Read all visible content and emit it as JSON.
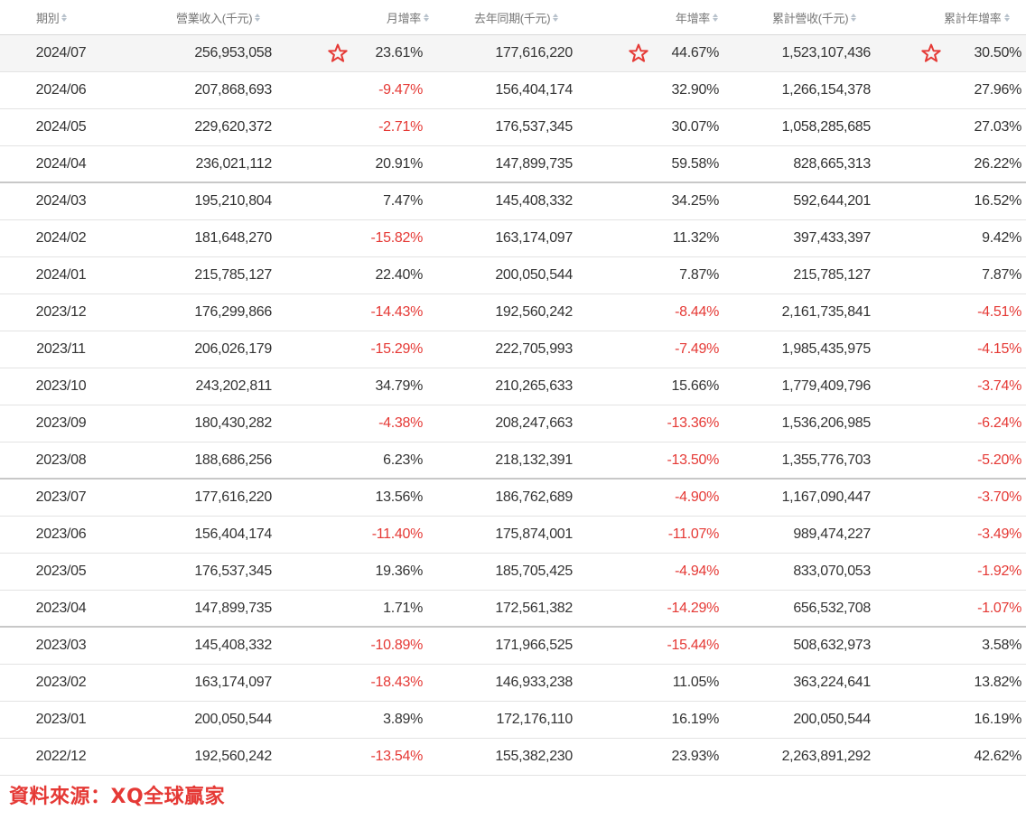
{
  "table": {
    "headers": {
      "period": "期別",
      "revenue": "營業收入(千元)",
      "mom": "月增率",
      "last_year": "去年同期(千元)",
      "yoy": "年增率",
      "cumulative": "累計營收(千元)",
      "cumulative_yoy": "累計年增率"
    },
    "rows": [
      {
        "period": "2024/07",
        "revenue": "256,953,058",
        "mom": "23.61%",
        "last_year": "177,616,220",
        "yoy": "44.67%",
        "cumulative": "1,523,107,436",
        "cumulative_yoy": "30.50%"
      },
      {
        "period": "2024/06",
        "revenue": "207,868,693",
        "mom": "-9.47%",
        "last_year": "156,404,174",
        "yoy": "32.90%",
        "cumulative": "1,266,154,378",
        "cumulative_yoy": "27.96%"
      },
      {
        "period": "2024/05",
        "revenue": "229,620,372",
        "mom": "-2.71%",
        "last_year": "176,537,345",
        "yoy": "30.07%",
        "cumulative": "1,058,285,685",
        "cumulative_yoy": "27.03%"
      },
      {
        "period": "2024/04",
        "revenue": "236,021,112",
        "mom": "20.91%",
        "last_year": "147,899,735",
        "yoy": "59.58%",
        "cumulative": "828,665,313",
        "cumulative_yoy": "26.22%"
      },
      {
        "period": "2024/03",
        "revenue": "195,210,804",
        "mom": "7.47%",
        "last_year": "145,408,332",
        "yoy": "34.25%",
        "cumulative": "592,644,201",
        "cumulative_yoy": "16.52%"
      },
      {
        "period": "2024/02",
        "revenue": "181,648,270",
        "mom": "-15.82%",
        "last_year": "163,174,097",
        "yoy": "11.32%",
        "cumulative": "397,433,397",
        "cumulative_yoy": "9.42%"
      },
      {
        "period": "2024/01",
        "revenue": "215,785,127",
        "mom": "22.40%",
        "last_year": "200,050,544",
        "yoy": "7.87%",
        "cumulative": "215,785,127",
        "cumulative_yoy": "7.87%"
      },
      {
        "period": "2023/12",
        "revenue": "176,299,866",
        "mom": "-14.43%",
        "last_year": "192,560,242",
        "yoy": "-8.44%",
        "cumulative": "2,161,735,841",
        "cumulative_yoy": "-4.51%"
      },
      {
        "period": "2023/11",
        "revenue": "206,026,179",
        "mom": "-15.29%",
        "last_year": "222,705,993",
        "yoy": "-7.49%",
        "cumulative": "1,985,435,975",
        "cumulative_yoy": "-4.15%"
      },
      {
        "period": "2023/10",
        "revenue": "243,202,811",
        "mom": "34.79%",
        "last_year": "210,265,633",
        "yoy": "15.66%",
        "cumulative": "1,779,409,796",
        "cumulative_yoy": "-3.74%"
      },
      {
        "period": "2023/09",
        "revenue": "180,430,282",
        "mom": "-4.38%",
        "last_year": "208,247,663",
        "yoy": "-13.36%",
        "cumulative": "1,536,206,985",
        "cumulative_yoy": "-6.24%"
      },
      {
        "period": "2023/08",
        "revenue": "188,686,256",
        "mom": "6.23%",
        "last_year": "218,132,391",
        "yoy": "-13.50%",
        "cumulative": "1,355,776,703",
        "cumulative_yoy": "-5.20%"
      },
      {
        "period": "2023/07",
        "revenue": "177,616,220",
        "mom": "13.56%",
        "last_year": "186,762,689",
        "yoy": "-4.90%",
        "cumulative": "1,167,090,447",
        "cumulative_yoy": "-3.70%"
      },
      {
        "period": "2023/06",
        "revenue": "156,404,174",
        "mom": "-11.40%",
        "last_year": "175,874,001",
        "yoy": "-11.07%",
        "cumulative": "989,474,227",
        "cumulative_yoy": "-3.49%"
      },
      {
        "period": "2023/05",
        "revenue": "176,537,345",
        "mom": "19.36%",
        "last_year": "185,705,425",
        "yoy": "-4.94%",
        "cumulative": "833,070,053",
        "cumulative_yoy": "-1.92%"
      },
      {
        "period": "2023/04",
        "revenue": "147,899,735",
        "mom": "1.71%",
        "last_year": "172,561,382",
        "yoy": "-14.29%",
        "cumulative": "656,532,708",
        "cumulative_yoy": "-1.07%"
      },
      {
        "period": "2023/03",
        "revenue": "145,408,332",
        "mom": "-10.89%",
        "last_year": "171,966,525",
        "yoy": "-15.44%",
        "cumulative": "508,632,973",
        "cumulative_yoy": "3.58%"
      },
      {
        "period": "2023/02",
        "revenue": "163,174,097",
        "mom": "-18.43%",
        "last_year": "146,933,238",
        "yoy": "11.05%",
        "cumulative": "363,224,641",
        "cumulative_yoy": "13.82%"
      },
      {
        "period": "2023/01",
        "revenue": "200,050,544",
        "mom": "3.89%",
        "last_year": "172,176,110",
        "yoy": "16.19%",
        "cumulative": "200,050,544",
        "cumulative_yoy": "16.19%"
      },
      {
        "period": "2022/12",
        "revenue": "192,560,242",
        "mom": "-13.54%",
        "last_year": "155,382,230",
        "yoy": "23.93%",
        "cumulative": "2,263,891,292",
        "cumulative_yoy": "42.62%"
      }
    ]
  },
  "star_marks": {
    "icon": "star-outline-icon",
    "color": "#e53935"
  },
  "colors": {
    "negative": "#e53935",
    "header_text": "#777777",
    "body_text": "#333333",
    "source_text": "#e53935"
  },
  "source": {
    "label": "資料來源：XQ全球贏家"
  }
}
